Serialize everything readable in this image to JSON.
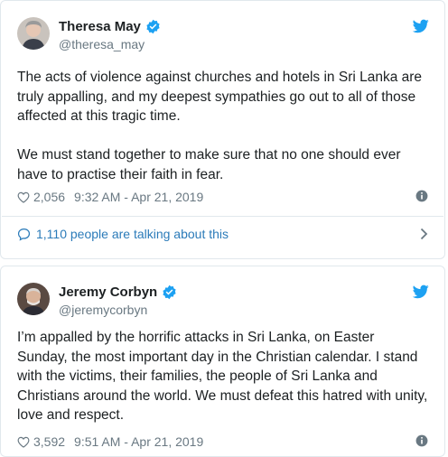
{
  "tweets": [
    {
      "author": {
        "name": "Theresa May",
        "handle": "@theresa_may",
        "verified": true
      },
      "paragraphs": [
        "The acts of violence against churches and hotels in Sri Lanka are truly appalling, and my deepest sympathies go out to all of those affected at this tragic time.",
        "We must stand together to make sure that no one should ever have to practise their faith in fear."
      ],
      "likes": "2,056",
      "timestamp": "9:32 AM - Apr 21, 2019",
      "talking": "1,110 people are talking about this"
    },
    {
      "author": {
        "name": "Jeremy Corbyn",
        "handle": "@jeremycorbyn",
        "verified": true
      },
      "paragraphs": [
        "I’m appalled by the horrific attacks in Sri Lanka, on Easter Sunday, the most important day in the Christian calendar. I stand with the victims, their families, the people of Sri Lanka and Christians around the world. We must defeat this hatred with unity, love and respect."
      ],
      "likes": "3,592",
      "timestamp": "9:51 AM - Apr 21, 2019"
    }
  ],
  "colors": {
    "twitter_blue": "#1da1f2",
    "link_blue": "#2b7bb9",
    "muted_text": "#697882",
    "border": "#e1e8ed"
  },
  "icons": [
    "twitter-bird-icon",
    "verified-badge-icon",
    "heart-icon",
    "info-icon",
    "speech-bubble-icon",
    "chevron-right-icon"
  ]
}
